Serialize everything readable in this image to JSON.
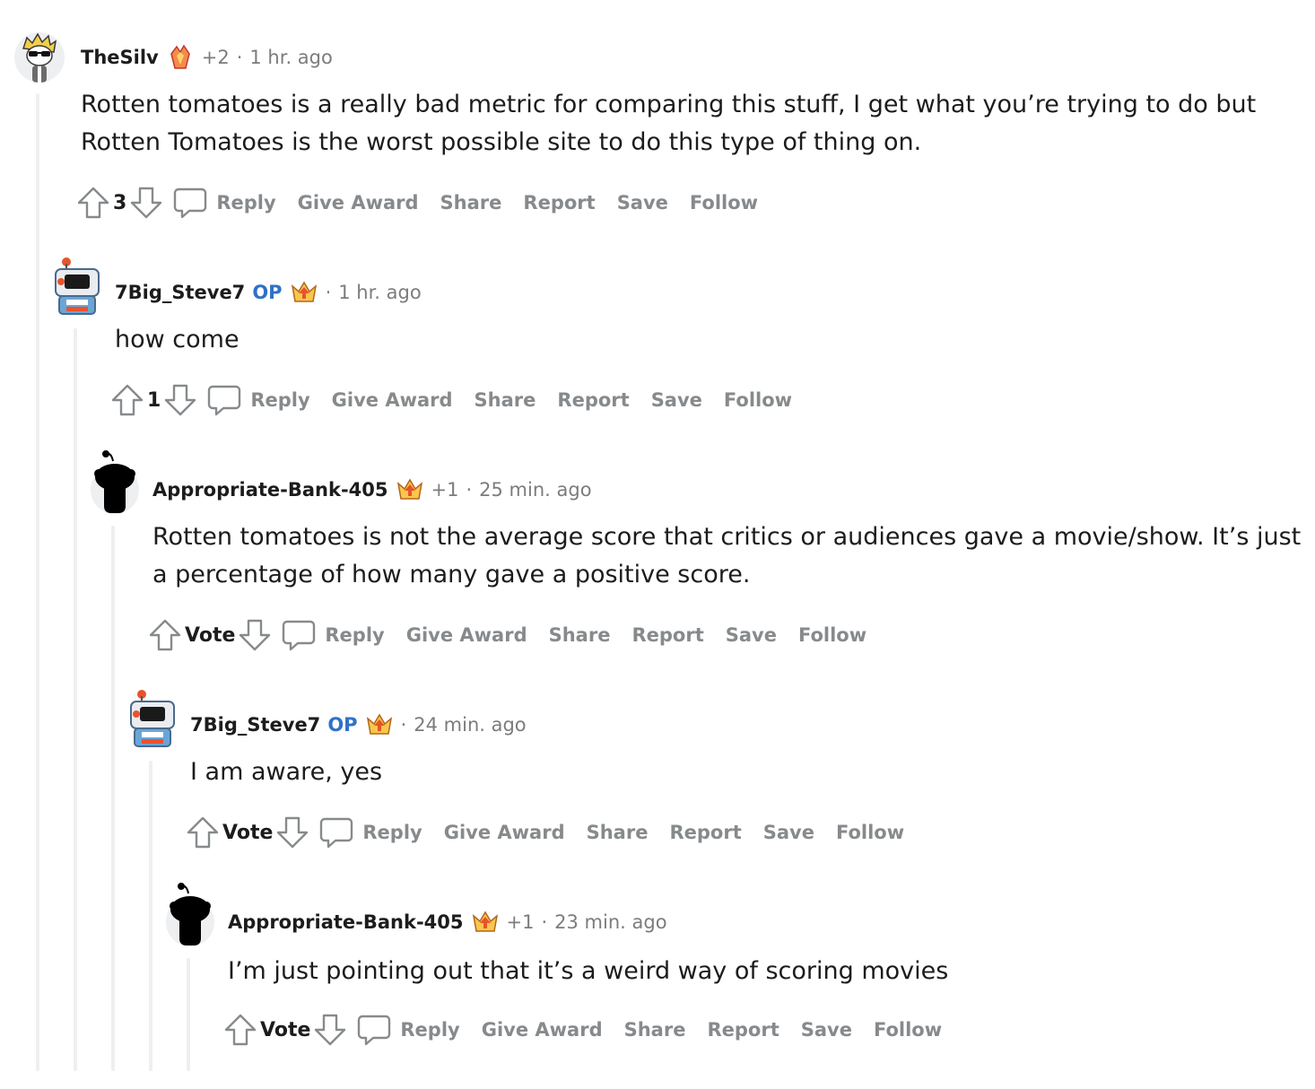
{
  "actions": {
    "reply": "Reply",
    "give_award": "Give Award",
    "share": "Share",
    "report": "Report",
    "save": "Save",
    "follow": "Follow"
  },
  "icons": {
    "upvote": "upvote-arrow-icon",
    "downvote": "downvote-arrow-icon",
    "reply": "speech-bubble-icon"
  },
  "colors": {
    "op_badge": "#3071c8",
    "action_text": "#878a8c",
    "thread_line": "#edeff1"
  },
  "comments": [
    {
      "username": "TheSilv",
      "op": "",
      "karma": "+2",
      "separator": "·",
      "time": "1 hr. ago",
      "body_lines": [
        "Rotten tomatoes is a really bad metric for comparing this stuff, I get what you’re trying to do but",
        "Rotten Tomatoes is the worst possible site to do this type of thing on."
      ],
      "score": "3",
      "avatar": "snoo-blonde-sunglasses-avatar",
      "flair": "crystal-award-icon"
    },
    {
      "username": "7Big_Steve7",
      "op": "OP",
      "karma": "",
      "separator": "·",
      "time": "1 hr. ago",
      "body_lines": [
        "how come"
      ],
      "score": "1",
      "avatar": "robot-snoo-avatar",
      "flair": "crown-award-icon"
    },
    {
      "username": "Appropriate-Bank-405",
      "op": "",
      "karma": "+1",
      "separator": "·",
      "time": "25 min. ago",
      "body_lines": [
        "Rotten tomatoes is not the average score that critics or audiences gave a movie/show. It’s just",
        "a percentage of how many gave a positive score."
      ],
      "score": "Vote",
      "avatar": "default-snoo-silhouette-avatar",
      "flair": "crown-award-icon"
    },
    {
      "username": "7Big_Steve7",
      "op": "OP",
      "karma": "",
      "separator": "·",
      "time": "24 min. ago",
      "body_lines": [
        "I am aware, yes"
      ],
      "score": "Vote",
      "avatar": "robot-snoo-avatar",
      "flair": "crown-award-icon"
    },
    {
      "username": "Appropriate-Bank-405",
      "op": "",
      "karma": "+1",
      "separator": "·",
      "time": "23 min. ago",
      "body_lines": [
        "I’m just pointing out that it’s a weird way of scoring movies"
      ],
      "score": "Vote",
      "avatar": "default-snoo-silhouette-avatar",
      "flair": "crown-award-icon"
    }
  ]
}
